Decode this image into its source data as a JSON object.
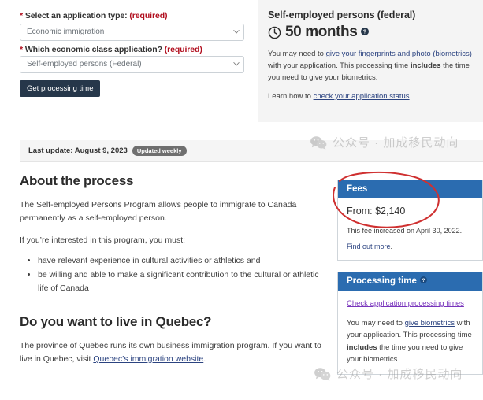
{
  "form": {
    "field1": {
      "label_star": "*",
      "label_text": "Select an application type:",
      "label_required": "(required)",
      "value": "Economic immigration",
      "caret_icon": "chevron-down-icon"
    },
    "field2": {
      "label_star": "*",
      "label_text": "Which economic class application?",
      "label_required": "(required)",
      "value": "Self-employed persons (Federal)",
      "caret_icon": "chevron-down-icon"
    },
    "submit_label": "Get processing time"
  },
  "result": {
    "title": "Self-employed persons (federal)",
    "clock_icon": "clock-icon",
    "duration": "50 months",
    "help_icon": "help-question-icon",
    "para1_part1": "You may need to ",
    "para1_link": "give your fingerprints and photo (biometrics)",
    "para1_part2": " with your application. This processing time ",
    "para1_bold": "includes",
    "para1_part3": " the time you need to give your biometrics.",
    "para2_part1": "Learn how to ",
    "para2_link": "check your application status",
    "para2_part2": "."
  },
  "last_update": {
    "text": "Last update: August 9, 2023",
    "badge": "Updated weekly"
  },
  "main": {
    "heading1": "About the process",
    "para1": "The Self-employed Persons Program allows people to immigrate to Canada permanently as a self-employed person.",
    "para2": "If you’re interested in this program, you must:",
    "bullets": [
      "have relevant experience in cultural activities or athletics and",
      "be willing and able to make a significant contribution to the cultural or athletic life of Canada"
    ],
    "heading2": "Do you want to live in Quebec?",
    "para3_part1": "The province of Quebec runs its own business immigration program. If you want to live in Quebec, visit ",
    "para3_link": "Quebec’s immigration website",
    "para3_part2": "."
  },
  "fees_card": {
    "title": "Fees",
    "amount": "From: $2,140",
    "note": "This fee increased on April 30, 2022.",
    "link": "Find out more",
    "link_suffix": "."
  },
  "processing_card": {
    "title": "Processing time",
    "help_icon": "help-question-icon",
    "link": "Check application processing times",
    "para_part1": "You may need to ",
    "para_link": "give biometrics",
    "para_part2": " with your application. This processing time ",
    "para_bold": "includes",
    "para_part3": " the time you need to give your biometrics."
  },
  "watermark": {
    "logo_icon": "wechat-logo-icon",
    "text": "公众号 · 加成移民动向"
  },
  "annotation": {
    "shape": "red-ellipse-highlight"
  },
  "colors": {
    "button_navy": "#26374a",
    "card_header_blue": "#2b6cb0",
    "required_red": "#b10e1e",
    "annotation_red": "#cf3030",
    "link_blue": "#2b4380",
    "link_visited_purple": "#7834bc",
    "panel_grey": "#f4f4f4",
    "badge_grey": "#6f6f6f"
  }
}
